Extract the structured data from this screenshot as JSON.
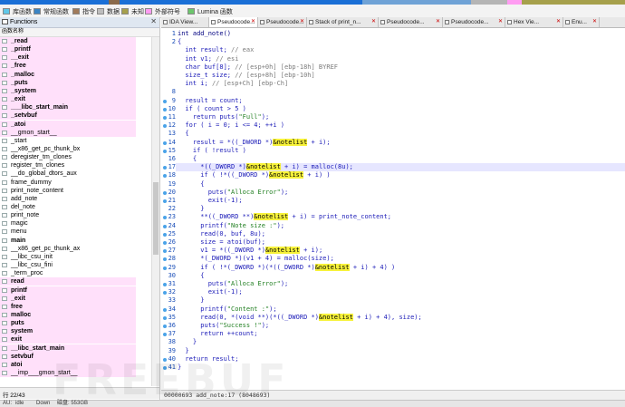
{
  "legend": [
    {
      "label": "库函数",
      "color": "#5fc7e8"
    },
    {
      "label": "常规函数",
      "color": "#3a84c4"
    },
    {
      "label": "指令",
      "color": "#a07a5a"
    },
    {
      "label": "数据",
      "color": "#bdbdbd"
    },
    {
      "label": "未知",
      "color": "#a6a04c"
    },
    {
      "label": "外部符号",
      "color": "#ff9cf2"
    },
    {
      "label": "Lumina 函数",
      "color": "#6cc66c"
    }
  ],
  "functions_panel": {
    "title": "Functions",
    "column_header": "函数名称",
    "status": "行 22/43",
    "items": [
      {
        "name": "_read",
        "pink": true,
        "bold": true
      },
      {
        "name": "_printf",
        "pink": true,
        "bold": true
      },
      {
        "name": "__exit",
        "pink": true,
        "bold": true
      },
      {
        "name": "_free",
        "pink": true,
        "bold": true
      },
      {
        "name": "_malloc",
        "pink": true,
        "bold": true
      },
      {
        "name": "_puts",
        "pink": true,
        "bold": true
      },
      {
        "name": "_system",
        "pink": true,
        "bold": true
      },
      {
        "name": "_exit",
        "pink": true,
        "bold": true
      },
      {
        "name": "___libc_start_main",
        "pink": true,
        "bold": true
      },
      {
        "name": "_setvbuf",
        "pink": true,
        "bold": true
      },
      {
        "name": "_atoi",
        "pink": true,
        "bold": true
      },
      {
        "name": "__gmon_start__",
        "pink": true,
        "bold": false
      },
      {
        "name": "_start",
        "pink": false,
        "bold": false
      },
      {
        "name": "__x86_get_pc_thunk_bx",
        "pink": false,
        "bold": false
      },
      {
        "name": "deregister_tm_clones",
        "pink": false,
        "bold": false
      },
      {
        "name": "register_tm_clones",
        "pink": false,
        "bold": false
      },
      {
        "name": "__do_global_dtors_aux",
        "pink": false,
        "bold": false
      },
      {
        "name": "frame_dummy",
        "pink": false,
        "bold": false
      },
      {
        "name": "print_note_content",
        "pink": false,
        "bold": false
      },
      {
        "name": "add_note",
        "pink": false,
        "bold": false
      },
      {
        "name": "del_note",
        "pink": false,
        "bold": false
      },
      {
        "name": "print_note",
        "pink": false,
        "bold": false
      },
      {
        "name": "magic",
        "pink": false,
        "bold": false
      },
      {
        "name": "menu",
        "pink": false,
        "bold": false
      },
      {
        "name": "main",
        "pink": false,
        "bold": true
      },
      {
        "name": "__x86_get_pc_thunk_ax",
        "pink": false,
        "bold": false
      },
      {
        "name": "__libc_csu_init",
        "pink": false,
        "bold": false
      },
      {
        "name": "__libc_csu_fini",
        "pink": false,
        "bold": false
      },
      {
        "name": "_term_proc",
        "pink": false,
        "bold": false
      },
      {
        "name": "read",
        "pink": true,
        "bold": true
      },
      {
        "name": "printf",
        "pink": true,
        "bold": true
      },
      {
        "name": "_exit",
        "pink": true,
        "bold": true
      },
      {
        "name": "free",
        "pink": true,
        "bold": true
      },
      {
        "name": "malloc",
        "pink": true,
        "bold": true
      },
      {
        "name": "puts",
        "pink": true,
        "bold": true
      },
      {
        "name": "system",
        "pink": true,
        "bold": true
      },
      {
        "name": "exit",
        "pink": true,
        "bold": true
      },
      {
        "name": "__libc_start_main",
        "pink": true,
        "bold": true
      },
      {
        "name": "setvbuf",
        "pink": true,
        "bold": true
      },
      {
        "name": "atoi",
        "pink": true,
        "bold": true
      },
      {
        "name": "__imp___gmon_start__",
        "pink": true,
        "bold": false
      }
    ]
  },
  "tabs": [
    {
      "label": "IDA View...",
      "active": false,
      "closable": false
    },
    {
      "label": "Pseudocode...",
      "active": true,
      "closable": true
    },
    {
      "label": "Pseudocode...",
      "active": false,
      "closable": true
    },
    {
      "label": "Stack of print_n...",
      "active": false,
      "closable": true
    },
    {
      "label": "Pseudocode...",
      "active": false,
      "closable": true
    },
    {
      "label": "Pseudocode...",
      "active": false,
      "closable": true
    },
    {
      "label": "Hex Vie...",
      "active": false,
      "closable": true
    },
    {
      "label": "Enu...",
      "active": false,
      "closable": true
    }
  ],
  "code": {
    "lines": [
      {
        "n": "1",
        "dot": false,
        "hl": false,
        "parts": [
          {
            "t": "int add_note()",
            "c": "kw"
          }
        ]
      },
      {
        "n": "2",
        "dot": false,
        "hl": false,
        "parts": [
          {
            "t": "{",
            "c": ""
          }
        ]
      },
      {
        "n": "",
        "dot": false,
        "hl": false,
        "parts": [
          {
            "t": "  int result; ",
            "c": ""
          },
          {
            "t": "// eax",
            "c": "cm"
          }
        ]
      },
      {
        "n": "",
        "dot": false,
        "hl": false,
        "parts": [
          {
            "t": "  int v1; ",
            "c": ""
          },
          {
            "t": "// esi",
            "c": "cm"
          }
        ]
      },
      {
        "n": "",
        "dot": false,
        "hl": false,
        "parts": [
          {
            "t": "  char buf[8]; ",
            "c": ""
          },
          {
            "t": "// [esp+0h] [ebp-18h] BYREF",
            "c": "cm"
          }
        ]
      },
      {
        "n": "",
        "dot": false,
        "hl": false,
        "parts": [
          {
            "t": "  size_t size; ",
            "c": ""
          },
          {
            "t": "// [esp+8h] [ebp-10h]",
            "c": "cm"
          }
        ]
      },
      {
        "n": "",
        "dot": false,
        "hl": false,
        "parts": [
          {
            "t": "  int i; ",
            "c": ""
          },
          {
            "t": "// [esp+Ch] [ebp-Ch]",
            "c": "cm"
          }
        ]
      },
      {
        "n": "8",
        "dot": false,
        "hl": false,
        "parts": [
          {
            "t": "",
            "c": ""
          }
        ]
      },
      {
        "n": "9",
        "dot": true,
        "hl": false,
        "parts": [
          {
            "t": "  result = count;",
            "c": ""
          }
        ]
      },
      {
        "n": "10",
        "dot": true,
        "hl": false,
        "parts": [
          {
            "t": "  if ( count > 5 )",
            "c": ""
          }
        ]
      },
      {
        "n": "11",
        "dot": true,
        "hl": false,
        "parts": [
          {
            "t": "    return puts(",
            "c": ""
          },
          {
            "t": "\"Full\"",
            "c": "st"
          },
          {
            "t": ");",
            "c": ""
          }
        ]
      },
      {
        "n": "12",
        "dot": true,
        "hl": false,
        "parts": [
          {
            "t": "  for ( i = 0; i <= 4; ++i )",
            "c": ""
          }
        ]
      },
      {
        "n": "13",
        "dot": false,
        "hl": false,
        "parts": [
          {
            "t": "  {",
            "c": ""
          }
        ]
      },
      {
        "n": "14",
        "dot": true,
        "hl": false,
        "parts": [
          {
            "t": "    result = *((_DWORD *)",
            "c": ""
          },
          {
            "t": "&notelist",
            "c": "hl"
          },
          {
            "t": " + i);",
            "c": ""
          }
        ]
      },
      {
        "n": "15",
        "dot": true,
        "hl": false,
        "parts": [
          {
            "t": "    if ( !result )",
            "c": ""
          }
        ]
      },
      {
        "n": "16",
        "dot": false,
        "hl": false,
        "parts": [
          {
            "t": "    {",
            "c": ""
          }
        ]
      },
      {
        "n": "17",
        "dot": true,
        "hl": true,
        "parts": [
          {
            "t": "      *((_DWORD *)",
            "c": ""
          },
          {
            "t": "&notelist",
            "c": "hl"
          },
          {
            "t": " + i) = malloc(8u);",
            "c": ""
          }
        ]
      },
      {
        "n": "18",
        "dot": true,
        "hl": false,
        "parts": [
          {
            "t": "      if ( !*((_DWORD *)",
            "c": ""
          },
          {
            "t": "&notelist",
            "c": "hl"
          },
          {
            "t": " + i) )",
            "c": ""
          }
        ]
      },
      {
        "n": "19",
        "dot": false,
        "hl": false,
        "parts": [
          {
            "t": "      {",
            "c": ""
          }
        ]
      },
      {
        "n": "20",
        "dot": true,
        "hl": false,
        "parts": [
          {
            "t": "        puts(",
            "c": ""
          },
          {
            "t": "\"Alloca Error\"",
            "c": "st"
          },
          {
            "t": ");",
            "c": ""
          }
        ]
      },
      {
        "n": "21",
        "dot": true,
        "hl": false,
        "parts": [
          {
            "t": "        exit(-1);",
            "c": ""
          }
        ]
      },
      {
        "n": "22",
        "dot": false,
        "hl": false,
        "parts": [
          {
            "t": "      }",
            "c": ""
          }
        ]
      },
      {
        "n": "23",
        "dot": true,
        "hl": false,
        "parts": [
          {
            "t": "      **((_DWORD **)",
            "c": ""
          },
          {
            "t": "&notelist",
            "c": "hl"
          },
          {
            "t": " + i) = print_note_content;",
            "c": ""
          }
        ]
      },
      {
        "n": "24",
        "dot": true,
        "hl": false,
        "parts": [
          {
            "t": "      printf(",
            "c": ""
          },
          {
            "t": "\"Note size :\"",
            "c": "st"
          },
          {
            "t": ");",
            "c": ""
          }
        ]
      },
      {
        "n": "25",
        "dot": true,
        "hl": false,
        "parts": [
          {
            "t": "      read(0, buf, 8u);",
            "c": ""
          }
        ]
      },
      {
        "n": "26",
        "dot": true,
        "hl": false,
        "parts": [
          {
            "t": "      size = atoi(buf);",
            "c": ""
          }
        ]
      },
      {
        "n": "27",
        "dot": true,
        "hl": false,
        "parts": [
          {
            "t": "      v1 = *((_DWORD *)",
            "c": ""
          },
          {
            "t": "&notelist",
            "c": "hl"
          },
          {
            "t": " + i);",
            "c": ""
          }
        ]
      },
      {
        "n": "28",
        "dot": true,
        "hl": false,
        "parts": [
          {
            "t": "      *(_DWORD *)(v1 + 4) = malloc(size);",
            "c": ""
          }
        ]
      },
      {
        "n": "29",
        "dot": true,
        "hl": false,
        "parts": [
          {
            "t": "      if ( !*(_DWORD *)(*((_DWORD *)",
            "c": ""
          },
          {
            "t": "&notelist",
            "c": "hl"
          },
          {
            "t": " + i) + 4) )",
            "c": ""
          }
        ]
      },
      {
        "n": "30",
        "dot": false,
        "hl": false,
        "parts": [
          {
            "t": "      {",
            "c": ""
          }
        ]
      },
      {
        "n": "31",
        "dot": true,
        "hl": false,
        "parts": [
          {
            "t": "        puts(",
            "c": ""
          },
          {
            "t": "\"Alloca Error\"",
            "c": "st"
          },
          {
            "t": ");",
            "c": ""
          }
        ]
      },
      {
        "n": "32",
        "dot": true,
        "hl": false,
        "parts": [
          {
            "t": "        exit(-1);",
            "c": ""
          }
        ]
      },
      {
        "n": "33",
        "dot": false,
        "hl": false,
        "parts": [
          {
            "t": "      }",
            "c": ""
          }
        ]
      },
      {
        "n": "34",
        "dot": true,
        "hl": false,
        "parts": [
          {
            "t": "      printf(",
            "c": ""
          },
          {
            "t": "\"Content :\"",
            "c": "st"
          },
          {
            "t": ");",
            "c": ""
          }
        ]
      },
      {
        "n": "35",
        "dot": true,
        "hl": false,
        "parts": [
          {
            "t": "      read(0, *(void **)(*((_DWORD *)",
            "c": ""
          },
          {
            "t": "&notelist",
            "c": "hl"
          },
          {
            "t": " + i) + 4), size);",
            "c": ""
          }
        ]
      },
      {
        "n": "36",
        "dot": true,
        "hl": false,
        "parts": [
          {
            "t": "      puts(",
            "c": ""
          },
          {
            "t": "\"Success !\"",
            "c": "st"
          },
          {
            "t": ");",
            "c": ""
          }
        ]
      },
      {
        "n": "37",
        "dot": true,
        "hl": false,
        "parts": [
          {
            "t": "      return ++count;",
            "c": ""
          }
        ]
      },
      {
        "n": "38",
        "dot": false,
        "hl": false,
        "parts": [
          {
            "t": "    }",
            "c": ""
          }
        ]
      },
      {
        "n": "39",
        "dot": false,
        "hl": false,
        "parts": [
          {
            "t": "  }",
            "c": ""
          }
        ]
      },
      {
        "n": "40",
        "dot": true,
        "hl": false,
        "parts": [
          {
            "t": "  return result;",
            "c": ""
          }
        ]
      },
      {
        "n": "41",
        "dot": true,
        "hl": false,
        "parts": [
          {
            "t": "}",
            "c": ""
          }
        ]
      }
    ],
    "status": "00000693 add_note:17 (8048693)"
  },
  "statusbar": {
    "state": "AU:",
    "idle": "idle",
    "direction": "Down",
    "disk": "磁盘: 553GB"
  },
  "watermark": "FREEBUF"
}
